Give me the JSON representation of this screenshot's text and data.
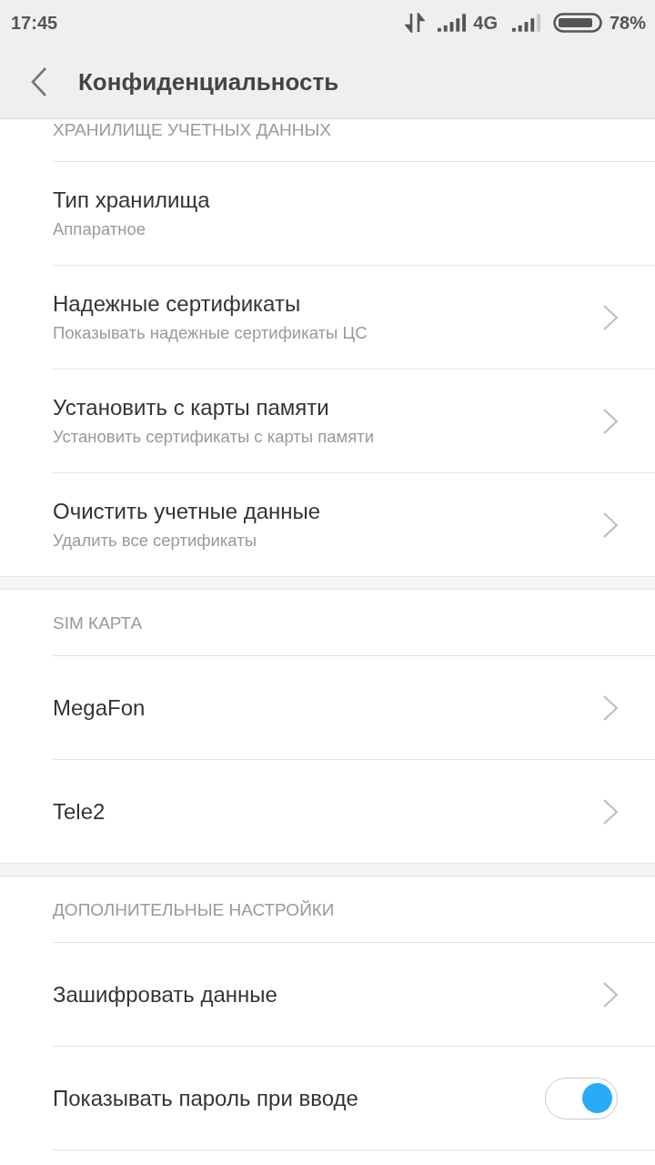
{
  "status_bar": {
    "time": "17:45",
    "network": "4G",
    "battery": "78%"
  },
  "header": {
    "title": "Конфиденциальность"
  },
  "sections": [
    {
      "title": "ХРАНИЛИЩЕ УЧЕТНЫХ ДАННЫХ",
      "items": [
        {
          "kind": "info",
          "title": "Тип хранилища",
          "subtitle": "Аппаратное"
        },
        {
          "kind": "link",
          "title": "Надежные сертификаты",
          "subtitle": "Показывать надежные сертификаты ЦС"
        },
        {
          "kind": "link",
          "title": "Установить с карты памяти",
          "subtitle": "Установить сертификаты с карты памяти"
        },
        {
          "kind": "link",
          "title": "Очистить учетные данные",
          "subtitle": "Удалить все сертификаты"
        }
      ]
    },
    {
      "title": "SIM КАРТА",
      "items": [
        {
          "kind": "link",
          "title": "MegaFon"
        },
        {
          "kind": "link",
          "title": "Tele2"
        }
      ]
    },
    {
      "title": "ДОПОЛНИТЕЛЬНЫЕ НАСТРОЙКИ",
      "items": [
        {
          "kind": "link",
          "title": "Зашифровать данные"
        },
        {
          "kind": "toggle",
          "title": "Показывать пароль при вводе",
          "on": true
        }
      ]
    }
  ]
}
